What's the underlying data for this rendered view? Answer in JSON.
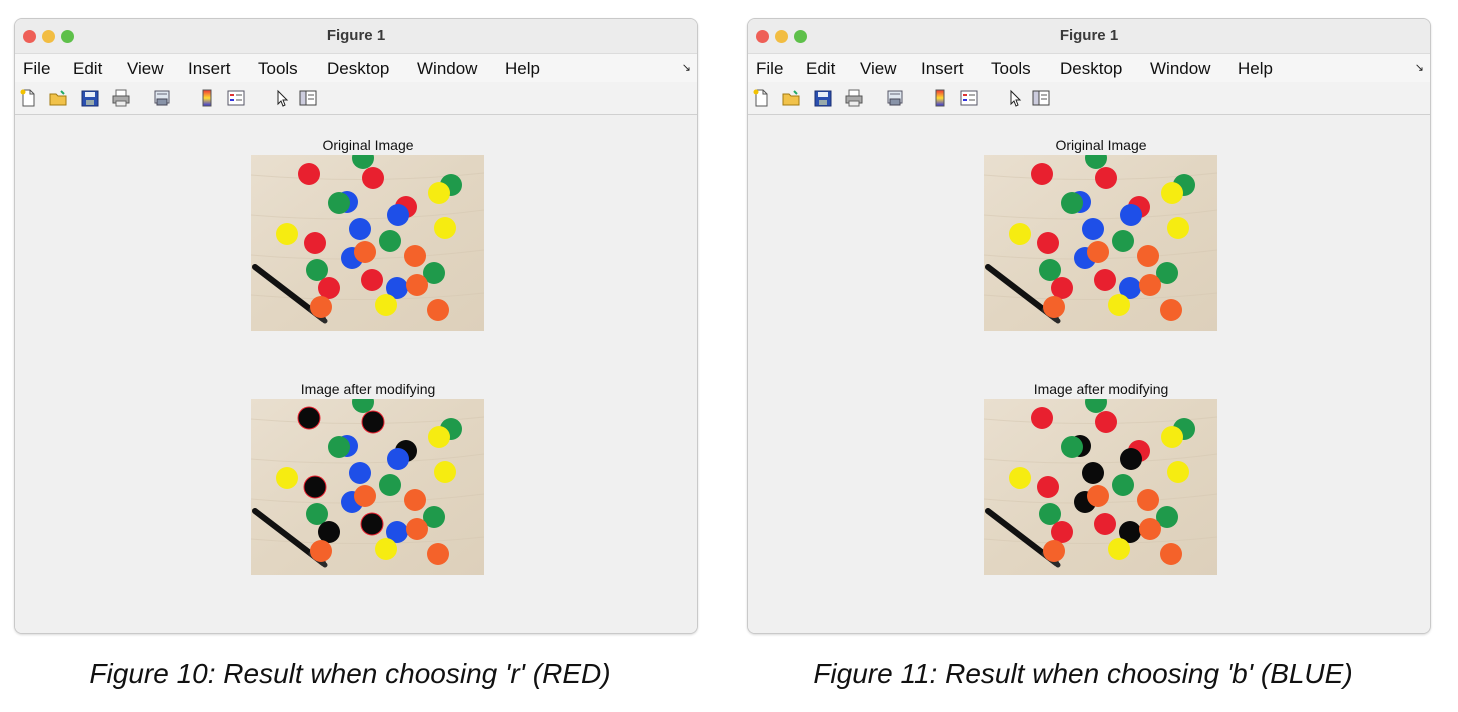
{
  "left": {
    "window_title": "Figure 1",
    "menu": [
      "File",
      "Edit",
      "View",
      "Insert",
      "Tools",
      "Desktop",
      "Window",
      "Help"
    ],
    "top_title": "Original Image",
    "bottom_title": "Image after modifying",
    "caption": "Figure 10: Result when choosing 'r' (RED)"
  },
  "right": {
    "window_title": "Figure 1",
    "menu": [
      "File",
      "Edit",
      "View",
      "Insert",
      "Tools",
      "Desktop",
      "Window",
      "Help"
    ],
    "top_title": "Original Image",
    "bottom_title": "Image after modifying",
    "caption": "Figure 11: Result when choosing 'b' (BLUE)"
  },
  "toolbar_icons": [
    "new-file-icon",
    "open-folder-icon",
    "save-icon",
    "print-icon",
    "print-preview-icon",
    "colorbar-icon",
    "legend-icon",
    "pointer-icon",
    "property-editor-icon"
  ],
  "colors": {
    "red": "#e8202f",
    "green": "#1f9a4b",
    "blue": "#1e4fe8",
    "yellow": "#f6ec11",
    "orange": "#f4622a",
    "black": "#0a0a0a",
    "wood": "#e7dccb"
  }
}
